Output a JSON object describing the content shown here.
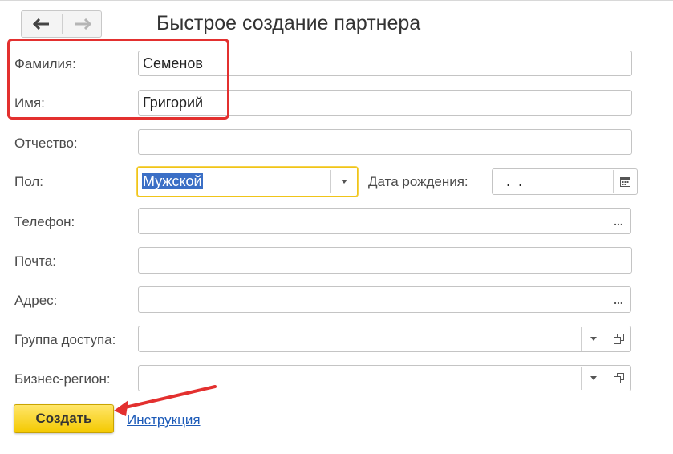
{
  "window": {
    "title": "Быстрое создание партнера"
  },
  "nav": {
    "back_icon": "arrow-left-icon",
    "forward_icon": "arrow-right-icon"
  },
  "form": {
    "last_name": {
      "label": "Фамилия:",
      "value": "Семенов"
    },
    "first_name": {
      "label": "Имя:",
      "value": "Григорий"
    },
    "middle_name": {
      "label": "Отчество:",
      "value": ""
    },
    "gender": {
      "label": "Пол:",
      "value": "Мужской"
    },
    "birth_date": {
      "label": "Дата рождения:",
      "value": " .  ."
    },
    "phone": {
      "label": "Телефон:",
      "value": "",
      "button": "..."
    },
    "email": {
      "label": "Почта:",
      "value": ""
    },
    "address": {
      "label": "Адрес:",
      "value": "",
      "button": "..."
    },
    "access_group": {
      "label": "Группа доступа:",
      "value": ""
    },
    "business_region": {
      "label": "Бизнес-регион:",
      "value": ""
    }
  },
  "actions": {
    "create_label": "Создать",
    "help_label": "Инструкция"
  },
  "colors": {
    "highlight_box": "#e3302f",
    "primary_button": "#f4c900",
    "focus_border": "#f0c419",
    "link": "#1d5bb8"
  }
}
